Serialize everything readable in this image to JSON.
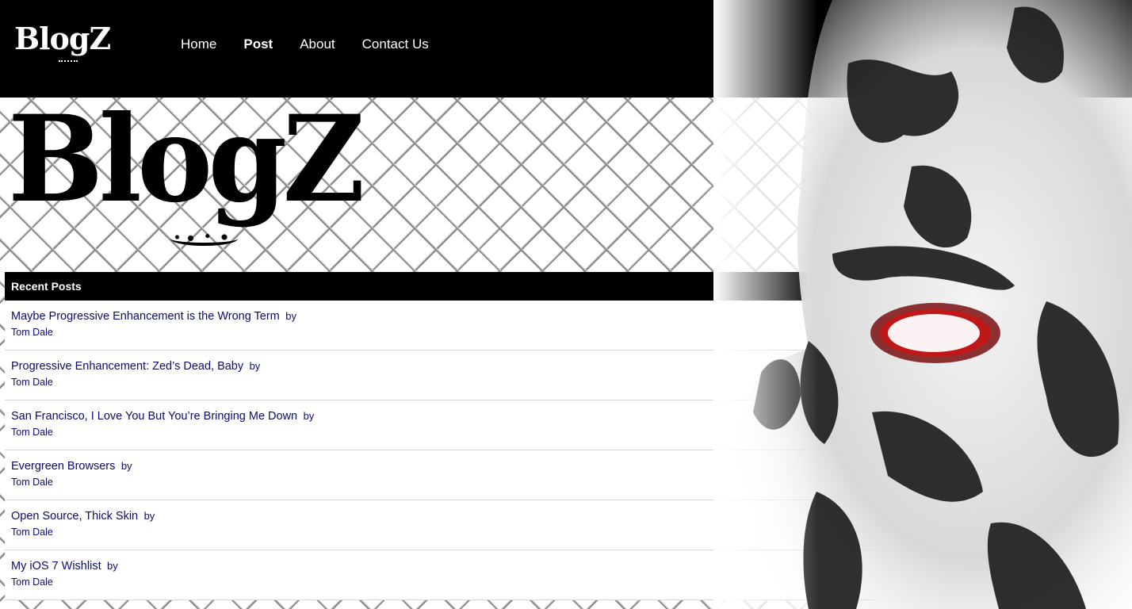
{
  "nav": {
    "logo": "BlogZ",
    "links": [
      {
        "label": "Home"
      },
      {
        "label": "Post"
      },
      {
        "label": "About"
      },
      {
        "label": "Contact Us"
      }
    ]
  },
  "hero": {
    "logo": "BlogZ"
  },
  "recent_posts": {
    "header": "Recent Posts",
    "by_label": "by",
    "items": [
      {
        "title": "Maybe Progressive Enhancement is the Wrong Term",
        "author": "Tom Dale"
      },
      {
        "title": "Progressive Enhancement: Zed’s Dead, Baby",
        "author": "Tom Dale"
      },
      {
        "title": "San Francisco, I Love You But You’re Bringing Me Down",
        "author": "Tom Dale"
      },
      {
        "title": "Evergreen Browsers",
        "author": "Tom Dale"
      },
      {
        "title": "Open Source, Thick Skin",
        "author": "Tom Dale"
      },
      {
        "title": "My iOS 7 Wishlist",
        "author": "Tom Dale"
      }
    ]
  },
  "colors": {
    "navbar": "#000000",
    "link": "#0b0b6e",
    "eye": "#c01818"
  }
}
